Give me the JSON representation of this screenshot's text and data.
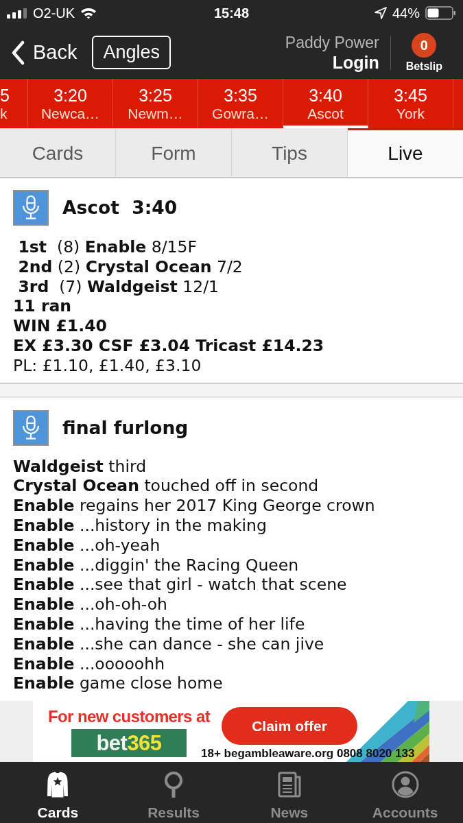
{
  "status_bar": {
    "carrier": "O2-UK",
    "time": "15:48",
    "battery": "44%"
  },
  "header": {
    "back": "Back",
    "angles": "Angles",
    "brand": "Paddy Power",
    "login": "Login",
    "betslip_count": "0",
    "betslip": "Betslip"
  },
  "races": [
    {
      "time": "5",
      "venue": "k",
      "selected": false
    },
    {
      "time": "3:20",
      "venue": "Newca…",
      "selected": false
    },
    {
      "time": "3:25",
      "venue": "Newm…",
      "selected": false
    },
    {
      "time": "3:35",
      "venue": "Gowra…",
      "selected": false
    },
    {
      "time": "3:40",
      "venue": "Ascot",
      "selected": true
    },
    {
      "time": "3:45",
      "venue": "York",
      "selected": false
    }
  ],
  "tabs": [
    {
      "label": "Cards",
      "selected": false
    },
    {
      "label": "Form",
      "selected": false
    },
    {
      "label": "Tips",
      "selected": false
    },
    {
      "label": "Live",
      "selected": true
    }
  ],
  "posts": [
    {
      "kind": "result",
      "title": "Ascot  3:40",
      "placings": [
        " **1st**  (8) **Enable** 8/15F",
        " **2nd** (2) **Crystal Ocean** 7/2",
        " **3rd**  (7) **Waldgeist** 12/1"
      ],
      "summary": [
        "11 ran",
        "WIN £1.40",
        "EX £3.30 CSF £3.04 Tricast £14.23"
      ],
      "place_dividends": "PL: £1.10, £1.40, £3.10"
    },
    {
      "kind": "commentary",
      "title": "final furlong",
      "lines": [
        "**Waldgeist** third",
        "**Crystal Ocean** touched off in second",
        "**Enable** regains her 2017 King George crown",
        "**Enable** ...history in the making",
        "**Enable** ...oh-yeah",
        "**Enable** ...diggin' the Racing Queen",
        "**Enable** ...see that girl - watch that scene",
        "**Enable** ...oh-oh-oh",
        "**Enable** ...having the time of her life",
        "**Enable** ...she can dance - she can jive",
        "**Enable** ...ooooohh",
        "**Enable** game close home"
      ]
    }
  ],
  "ad": {
    "headline": "For new customers at",
    "logo_text": "bet",
    "logo_accent": "365",
    "cta": "Claim offer",
    "disclaimer": "18+ begambleaware.org 0808 8020 133"
  },
  "nav": [
    {
      "label": "Cards",
      "selected": true
    },
    {
      "label": "Results",
      "selected": false
    },
    {
      "label": "News",
      "selected": false
    },
    {
      "label": "Accounts",
      "selected": false
    }
  ]
}
